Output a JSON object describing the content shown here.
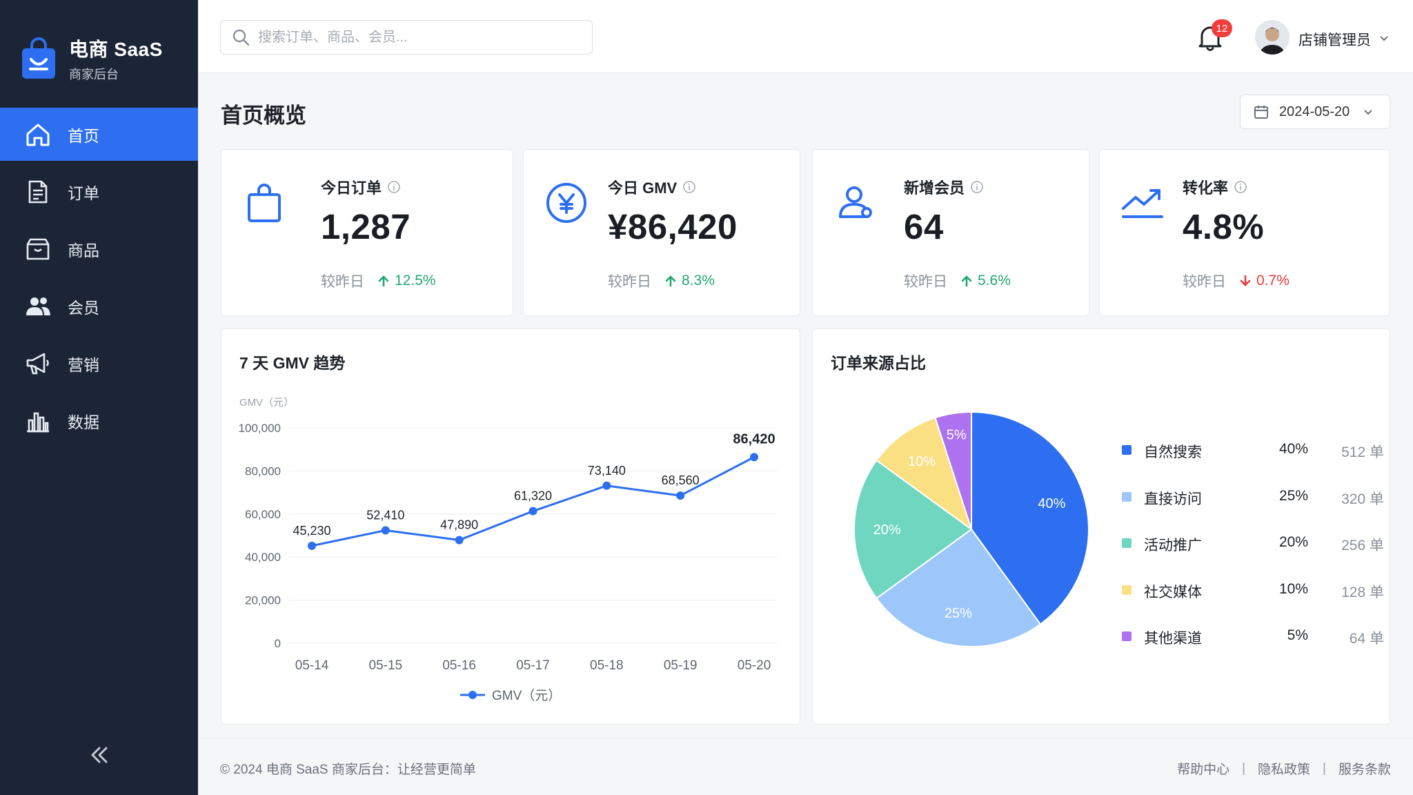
{
  "brand": {
    "name": "电商 SaaS",
    "subtitle": "商家后台"
  },
  "sidebar": {
    "items": [
      {
        "label": "首页",
        "icon": "home-icon",
        "active": true
      },
      {
        "label": "订单",
        "icon": "order-icon",
        "active": false
      },
      {
        "label": "商品",
        "icon": "product-box-icon",
        "active": false
      },
      {
        "label": "会员",
        "icon": "members-icon",
        "active": false
      },
      {
        "label": "营销",
        "icon": "megaphone-icon",
        "active": false
      },
      {
        "label": "数据",
        "icon": "bar-chart-icon",
        "active": false
      }
    ],
    "collapse_icon": "double-chevron-left-icon"
  },
  "topbar": {
    "search_placeholder": "搜索订单、商品、会员...",
    "notification_count": "12",
    "user_name": "店铺管理员"
  },
  "page": {
    "title": "首页概览",
    "date": "2024-05-20"
  },
  "stats": [
    {
      "label": "今日订单",
      "value": "1,287",
      "compare_label": "较昨日",
      "delta": "12.5%",
      "direction": "up",
      "icon": "shopping-bag-icon"
    },
    {
      "label": "今日 GMV",
      "value": "¥86,420",
      "compare_label": "较昨日",
      "delta": "8.3%",
      "direction": "up",
      "icon": "yen-coin-icon"
    },
    {
      "label": "新增会员",
      "value": "64",
      "compare_label": "较昨日",
      "delta": "5.6%",
      "direction": "up",
      "icon": "user-add-icon"
    },
    {
      "label": "转化率",
      "value": "4.8%",
      "compare_label": "较昨日",
      "delta": "0.7%",
      "direction": "down",
      "icon": "trend-up-icon"
    }
  ],
  "colors": {
    "primary": "#2d6ff0",
    "up": "#1fa870",
    "down": "#e83a3a",
    "sidebar": "#1c2536"
  },
  "chart_data": [
    {
      "type": "line",
      "title": "7 天 GMV 趋势",
      "ylabel": "GMV（元）",
      "x": [
        "05-14",
        "05-15",
        "05-16",
        "05-17",
        "05-18",
        "05-19",
        "05-20"
      ],
      "series": [
        {
          "name": "GMV（元）",
          "values": [
            45230,
            52410,
            47890,
            61320,
            73140,
            68560,
            86420
          ],
          "color": "#2d6ff0"
        }
      ],
      "data_labels": [
        "45,230",
        "52,410",
        "47,890",
        "61,320",
        "73,140",
        "68,560",
        "86,420"
      ],
      "yticks": [
        0,
        20000,
        40000,
        60000,
        80000,
        100000
      ],
      "ytick_labels": [
        "0",
        "20,000",
        "40,000",
        "60,000",
        "80,000",
        "100,000"
      ],
      "ylim": [
        0,
        100000
      ],
      "grid": true,
      "legend": "bottom"
    },
    {
      "type": "pie",
      "title": "订单来源占比",
      "categories": [
        "自然搜索",
        "直接访问",
        "活动推广",
        "社交媒体",
        "其他渠道"
      ],
      "values": [
        40,
        25,
        20,
        10,
        5
      ],
      "percent_labels": [
        "40%",
        "25%",
        "20%",
        "10%",
        "5%"
      ],
      "counts": [
        "512 单",
        "320 单",
        "256 单",
        "128 单",
        "64 单"
      ],
      "colors": [
        "#2d6ff0",
        "#9dc6fb",
        "#6fd6c0",
        "#fbdf83",
        "#ad72f0"
      ],
      "legend": "right"
    }
  ],
  "footer": {
    "copyright": "© 2024 电商 SaaS 商家后台：让经营更简单",
    "links": [
      "帮助中心",
      "隐私政策",
      "服务条款"
    ],
    "separator": "|"
  }
}
